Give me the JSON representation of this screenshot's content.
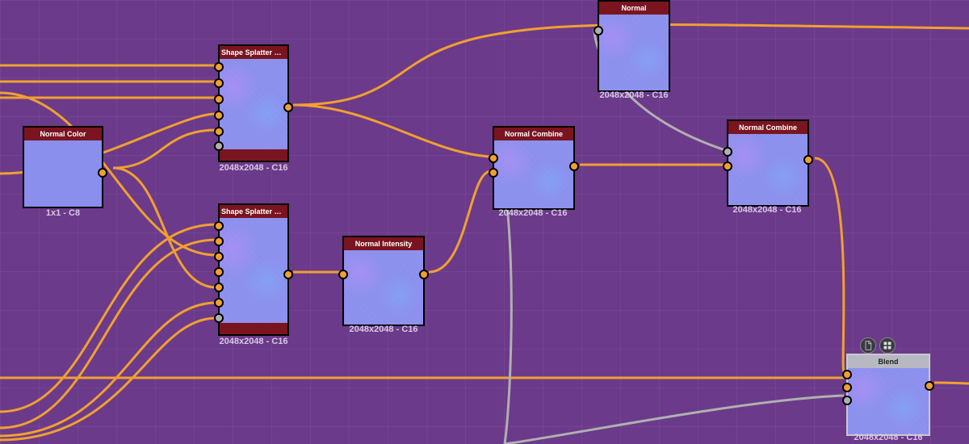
{
  "resolution_c16": "2048x2048 - C16",
  "resolution_c8": "1x1 - C8",
  "nodes": {
    "normal_color": {
      "title": "Normal Color"
    },
    "splatter1": {
      "title": "Shape Splatter Blend C..."
    },
    "splatter2": {
      "title": "Shape Splatter Blend C..."
    },
    "normal_intensity": {
      "title": "Normal Intensity"
    },
    "normal_combine1": {
      "title": "Normal Combine"
    },
    "normal_combine2": {
      "title": "Normal Combine"
    },
    "normal": {
      "title": "Normal"
    },
    "blend": {
      "title": "Blend"
    }
  },
  "icons": {
    "doc": "document-icon",
    "palette": "palette-icon"
  }
}
